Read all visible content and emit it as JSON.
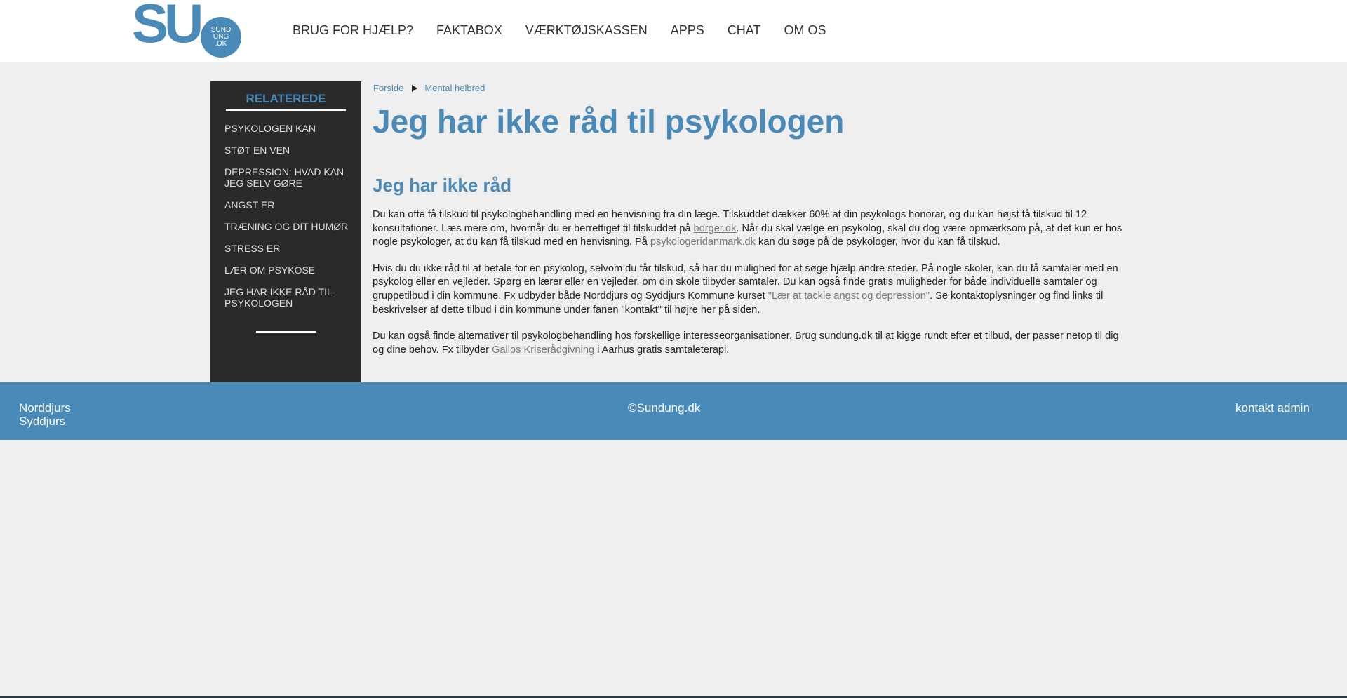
{
  "logo": {
    "letters": "SU",
    "bubble_lines": [
      "SUND",
      "UNG",
      ".DK"
    ],
    "brand_color": "#4a8ab8"
  },
  "nav": {
    "items": [
      "BRUG FOR HJÆLP?",
      "FAKTABOX",
      "VÆRKTØJSKASSEN",
      "APPS",
      "CHAT",
      "OM OS"
    ]
  },
  "social": {
    "icons": [
      "search-icon",
      "facebook-icon",
      "instagram-icon"
    ]
  },
  "sidebar": {
    "heading": "RELATEREDE",
    "items": [
      "PSYKOLOGEN KAN",
      "STØT EN VEN",
      "DEPRESSION: HVAD KAN JEG SELV GØRE",
      "ANGST ER",
      "TRÆNING OG DIT HUMØR",
      "STRESS ER",
      "LÆR OM PSYKOSE",
      "JEG HAR IKKE RÅD TIL PSYKOLOGEN"
    ]
  },
  "breadcrumb": {
    "home": "Forside",
    "current": "Mental helbred"
  },
  "page": {
    "title": "Jeg har ikke råd til psykologen",
    "subtitle": "Jeg har ikke råd"
  },
  "content": {
    "p1_a": "Du kan ofte få tilskud til psykologbehandling med en henvisning fra din læge. Tilskuddet dækker 60% af din psykologs honorar, og du kan højst få tilskud til 12 konsultationer. Læs mere om, hvornår du er berrettiget til tilskuddet på ",
    "p1_link1": "borger.dk",
    "p1_b": ". Når du skal vælge en psykolog, skal du dog være opmærksom på, at det kun er hos nogle psykologer, at du kan få tilskud med en henvisning. På ",
    "p1_link2": "psykologeridanmark.dk",
    "p1_c": " kan du søge på de psykologer, hvor du kan få tilskud.",
    "p2_a": "Hvis du du ikke råd til at betale for en psykolog, selvom du får tilskud, så har du mulighed for at søge hjælp andre steder. På nogle skoler, kan du få samtaler med en psykolog eller en vejleder. Spørg en lærer eller en vejleder, om din skole tilbyder samtaler. Du kan også finde gratis muligheder for både individuelle samtaler og gruppetilbud i din kommune. Fx udbyder både Norddjurs og Syddjurs Kommune kurset ",
    "p2_link": "\"Lær at tackle angst og depression\"",
    "p2_b": ". Se kontaktoplysninger og find links til beskrivelser af dette tilbud i din kommune under fanen \"kontakt\" til højre her på siden.",
    "p3_a": "Du kan også finde alternativer til psykologbehandling hos forskellige interesseorganisationer. Brug sundung.dk til at kigge rundt efter et tilbud, der passer netop til dig og dine behov. Fx tilbyder ",
    "p3_link": "Gallos Kriserådgivning",
    "p3_b": " i Aarhus gratis samtaleterapi."
  },
  "footer": {
    "left_line1": "Norddjurs",
    "left_line2": "Syddjurs",
    "center": "©Sundung.dk",
    "right": "kontakt admin"
  }
}
